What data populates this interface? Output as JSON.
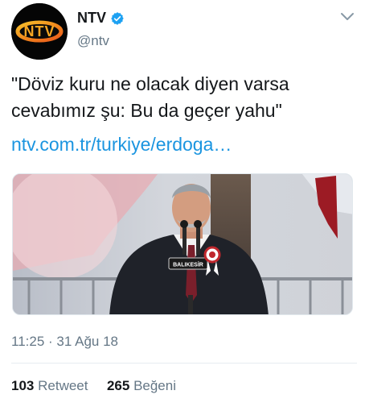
{
  "account": {
    "display_name": "NTV",
    "handle": "@ntv",
    "avatar_text": "NTV",
    "verified_icon": "verified-badge-icon",
    "menu_icon": "chevron-down-icon"
  },
  "tweet": {
    "text_line1": "\"Döviz kuru ne olacak diyen varsa",
    "text_line2": "cevabımız şu: Bu da geçer yahu\"",
    "link": "ntv.com.tr/turkiye/erdoga…"
  },
  "media": {
    "podium_sign": "BALIKESİR"
  },
  "meta": {
    "time": "11:25",
    "separator": "·",
    "date": "31 Ağu 18"
  },
  "stats": {
    "retweet_count": "103",
    "retweet_label": "Retweet",
    "like_count": "265",
    "like_label": "Beğeni"
  },
  "colors": {
    "link": "#1b95e0",
    "verified": "#1da1f2",
    "secondary_text": "#657786"
  }
}
